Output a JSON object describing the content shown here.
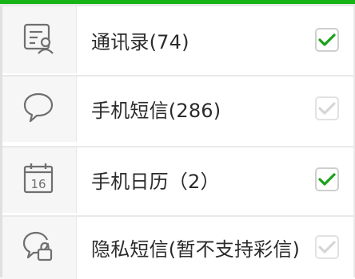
{
  "items": [
    {
      "label": "通讯录(74)",
      "icon": "contacts-icon",
      "checked": true,
      "enabled": true
    },
    {
      "label": "手机短信(286)",
      "icon": "sms-bubble-icon",
      "checked": true,
      "enabled": false
    },
    {
      "label": "手机日历（2）",
      "icon": "calendar-icon",
      "calendar_day": "16",
      "checked": true,
      "enabled": true
    },
    {
      "label": "隐私短信(暂不支持彩信)",
      "icon": "private-sms-lock-icon",
      "checked": true,
      "enabled": false
    }
  ],
  "colors": {
    "accent": "#16b416",
    "check_active": "#1aa11a",
    "check_disabled": "#d6d6d6",
    "icon": "#6f6f6f"
  }
}
